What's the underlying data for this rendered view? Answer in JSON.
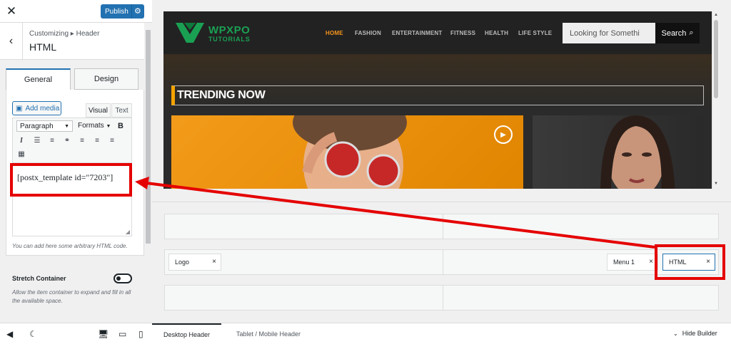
{
  "topbar": {
    "close_glyph": "✕",
    "publish_label": "Publish",
    "gear_glyph": "⚙"
  },
  "section": {
    "breadcrumb": "Customizing ▸ Header",
    "title": "HTML",
    "back_glyph": "‹"
  },
  "tabs": [
    {
      "label": "General"
    },
    {
      "label": "Design"
    }
  ],
  "editor": {
    "add_media": "Add media",
    "modes": [
      "Visual",
      "Text"
    ],
    "paragraph": "Paragraph",
    "formats": "Formats",
    "bold": "B",
    "content": "[postx_template id=\"7203\"]",
    "description": "You can add here some arbitrary HTML code."
  },
  "stretch": {
    "label": "Stretch Container",
    "description": "Allow the item container to expand and fill in all the available space.",
    "enabled": false
  },
  "preview": {
    "logo_text": "WPXPO",
    "logo_sub": "TUTORIALS",
    "nav": [
      "HOME",
      "FASHION",
      "ENTERTAINMENT",
      "FITNESS",
      "HEALTH",
      "LIFE STYLE"
    ],
    "search_placeholder": "Looking for Somethi",
    "search_button": "Search",
    "trending": "TRENDING NOW"
  },
  "builder": {
    "chips": [
      {
        "label": "Logo"
      },
      {
        "label": "Menu 1"
      },
      {
        "label": "HTML"
      }
    ],
    "close_glyph": "×"
  },
  "bottom_tabs": [
    {
      "label": "Desktop Header"
    },
    {
      "label": "Tablet / Mobile Header"
    }
  ],
  "hide_builder": "Hide Builder",
  "colors": {
    "accent": "#2271b1",
    "highlight": "#e50000",
    "brand_green": "#1aa053",
    "nav_active": "#f7941d"
  }
}
